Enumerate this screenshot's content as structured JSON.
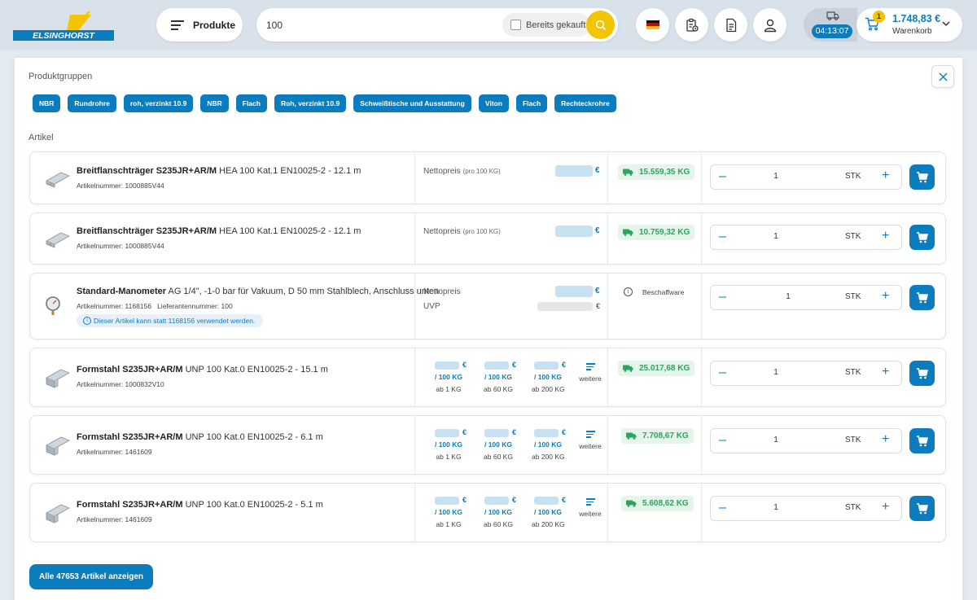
{
  "header": {
    "logo_text": "ELSINGHORST",
    "products_label": "Produkte",
    "search_value": "100",
    "already_bought_label": "Bereits gekauft",
    "timer": "04:13:07",
    "cart": {
      "badge": "1",
      "amount": "1.748,83 €",
      "label": "Warenkorb"
    }
  },
  "panel": {
    "groups_label": "Produktgruppen",
    "chips": [
      "NBR",
      "Rundrohre",
      "roh, verzinkt 10.9",
      "NBR",
      "Flach",
      "Roh, verzinkt 10.9",
      "Schweißtische und Ausstattung",
      "Viton",
      "Flach",
      "Rechteckrohre"
    ],
    "articles_label": "Artikel",
    "show_all_label": "Alle 47653 Artikel anzeigen"
  },
  "rows": [
    {
      "title_bold": "Breitflanschträger S235JR+AR/M",
      "title_rest": " HEA 100 Kat.1 EN10025-2 - 12.1 m",
      "artno": "Artikelnummer: 1000885V44",
      "price_label": "Nettopreis",
      "price_unit": "(pro 100 KG)",
      "euro": "€",
      "stock": "15.559,35 KG",
      "qty": "1",
      "unit": "STK"
    },
    {
      "title_bold": "Breitflanschträger S235JR+AR/M",
      "title_rest": " HEA 100 Kat.1 EN10025-2 - 12.1 m",
      "artno": "Artikelnummer: 1000885V44",
      "price_label": "Nettopreis",
      "price_unit": "(pro 100 KG)",
      "euro": "€",
      "stock": "10.759,32 KG",
      "qty": "1",
      "unit": "STK"
    },
    {
      "title_bold": "Standard-Manometer",
      "title_rest": " AG 1/4\", -1-0 bar für Vakuum, D 50 mm Stahlblech, Anschluss unten",
      "artno": "Artikelnummer: 1168156",
      "supplier": "Lieferantennummer: 100",
      "note": "Dieser Artikel kann statt 1168156 verwendet werden.",
      "price_label": "Nettopreis",
      "uvp_label": "UVP",
      "euro": "€",
      "procurement": "Beschaffware",
      "qty": "1",
      "unit": "STK"
    },
    {
      "title_bold": "Formstahl S235JR+AR/M",
      "title_rest": " UNP 100 Kat.0 EN10025-2 - 15.1 m",
      "artno": "Artikelnummer: 1000832V10",
      "stock": "25.017,68 KG",
      "qty": "1",
      "unit": "STK"
    },
    {
      "title_bold": "Formstahl S235JR+AR/M",
      "title_rest": " UNP 100 Kat.0 EN10025-2 - 6.1 m",
      "artno": "Artikelnummer: 1461609",
      "stock": "7.708,67 KG",
      "qty": "1",
      "unit": "STK"
    },
    {
      "title_bold": "Formstahl S235JR+AR/M",
      "title_rest": " UNP 100 Kat.0 EN10025-2 - 5.1 m",
      "artno": "Artikelnummer: 1461609",
      "stock": "5.608,62 KG",
      "qty": "1",
      "unit": "STK"
    }
  ],
  "tiers": {
    "euro": "€",
    "unit": "/ 100 KG",
    "mins": [
      "ab 1 KG",
      "ab 60 KG",
      "ab 200 KG"
    ],
    "more_label": "weitere"
  },
  "colors": {
    "brand": "#0b7dbe",
    "accent": "#f4c400",
    "stock_green": "#2aa560"
  },
  "icons": [
    "menu-icon",
    "search-icon",
    "german-flag-icon",
    "clipboard-icon",
    "document-icon",
    "user-icon",
    "truck-icon",
    "cart-icon",
    "chevron-down-icon",
    "close-icon",
    "info-icon",
    "plus-icon",
    "minus-icon"
  ]
}
